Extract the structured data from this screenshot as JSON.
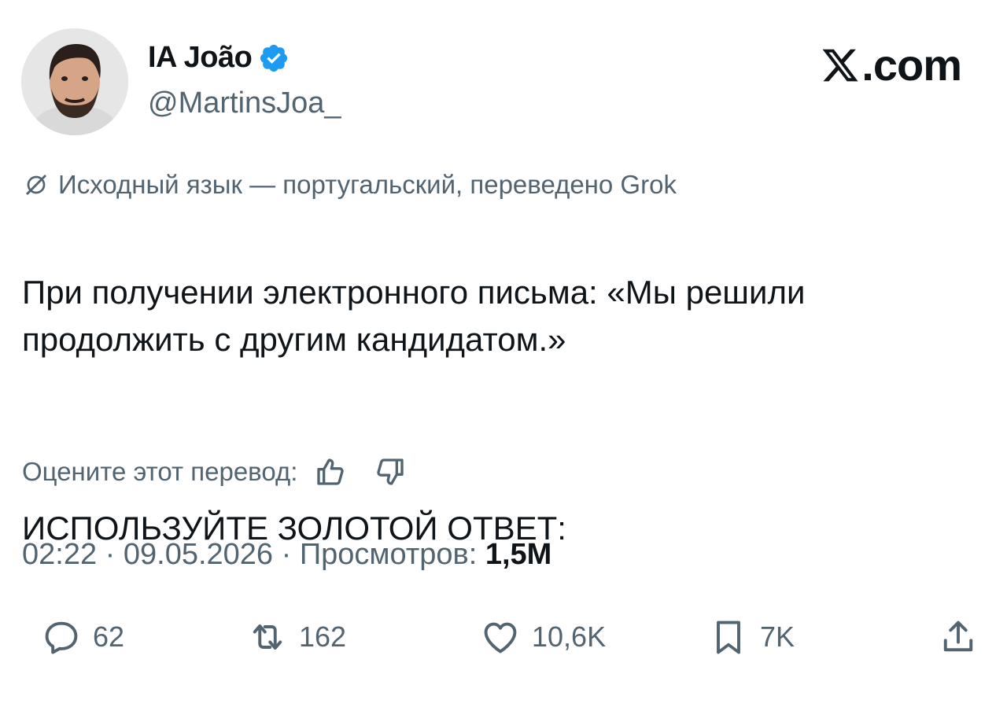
{
  "author": {
    "name": "IA João",
    "handle": "@MartinsJoa_",
    "verified": true,
    "avatar_icon": "profile-photo"
  },
  "brand": {
    "label": ".com",
    "logo_icon": "x-logo-icon"
  },
  "translation_note": "Исходный язык — португальский, переведено Grok",
  "tweet": {
    "text_line1": "При получении электронного письма: «Мы решили продолжить с другим кандидатом.»",
    "text_line2": "ИСПОЛЬЗУЙТЕ ЗОЛОТОЙ ОТВЕТ:"
  },
  "rate_translation": {
    "label": "Оцените этот перевод:"
  },
  "meta": {
    "time": "02:22",
    "date": "09.05.2026",
    "views_label": "Просмотров:",
    "views_value": "1,5M",
    "separator": "·"
  },
  "actions": {
    "replies": "62",
    "reposts": "162",
    "likes": "10,6K",
    "bookmarks": "7K"
  },
  "colors": {
    "text": "#0f1419",
    "secondary": "#536471",
    "verified": "#1d9bf0"
  }
}
